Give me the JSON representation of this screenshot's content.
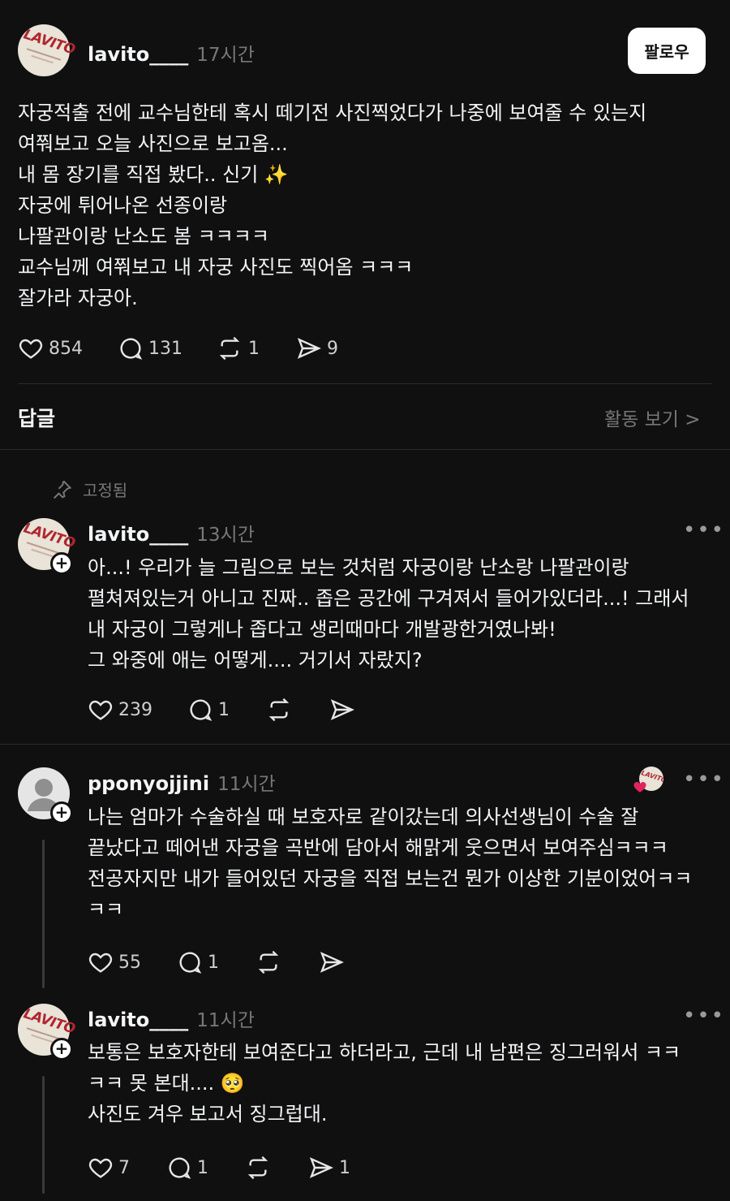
{
  "post": {
    "username": "lavito____",
    "time": "17시간",
    "follow_label": "팔로우",
    "body": "자궁적출 전에 교수님한테 혹시 떼기전 사진찍었다가 나중에 보여줄 수 있는지\n여쭤보고 오늘 사진으로 보고옴...\n내 몸 장기를 직접 봤다.. 신기 ✨\n자궁에 튀어나온 선종이랑\n나팔관이랑 난소도 봄 ㅋㅋㅋㅋ\n교수님께 여쭤보고 내 자궁 사진도 찍어옴 ㅋㅋㅋ\n잘가라 자궁아.",
    "likes": "854",
    "comments": "131",
    "reposts": "1",
    "shares": "9"
  },
  "replies_header": {
    "title": "답글",
    "activity_link": "활동 보기 >"
  },
  "pinned_label": "고정됨",
  "avatar_logo": "LAVITO",
  "replies": [
    {
      "username": "lavito____",
      "time": "13시간",
      "body": "아...! 우리가 늘 그림으로 보는 것처럼 자궁이랑 난소랑 나팔관이랑\n펼쳐져있는거 아니고 진짜.. 좁은 공간에 구겨져서 들어가있더라...! 그래서\n내 자궁이 그렇게나 좁다고 생리때마다 개발광한거였나봐!\n그 와중에 애는 어떻게.... 거기서 자랐지?",
      "likes": "239",
      "comments": "1",
      "reposts": "",
      "shares": ""
    },
    {
      "username": "pponyojjini",
      "time": "11시간",
      "body": "나는 엄마가 수술하실 때 보호자로 같이갔는데 의사선생님이 수술 잘\n끝났다고 떼어낸 자궁을 곡반에 담아서 해맑게 웃으면서 보여주심ㅋㅋㅋ\n전공자지만 내가 들어있던 자궁을 직접 보는건 뭔가 이상한 기분이었어ㅋㅋ\nㅋㅋ",
      "likes": "55",
      "comments": "1",
      "reposts": "",
      "shares": ""
    },
    {
      "username": "lavito____",
      "time": "11시간",
      "body": "보통은 보호자한테 보여준다고 하더라고, 근데 내 남편은 징그러워서 ㅋㅋ\nㅋㅋ 못 본대.... 🥺\n사진도 겨우 보고서 징그럽대.",
      "likes": "7",
      "comments": "1",
      "reposts": "",
      "shares": "1"
    }
  ],
  "colors": {
    "background": "#101010",
    "text": "#f3f5f7",
    "muted": "#777777",
    "like_heart": "#e0245e"
  }
}
